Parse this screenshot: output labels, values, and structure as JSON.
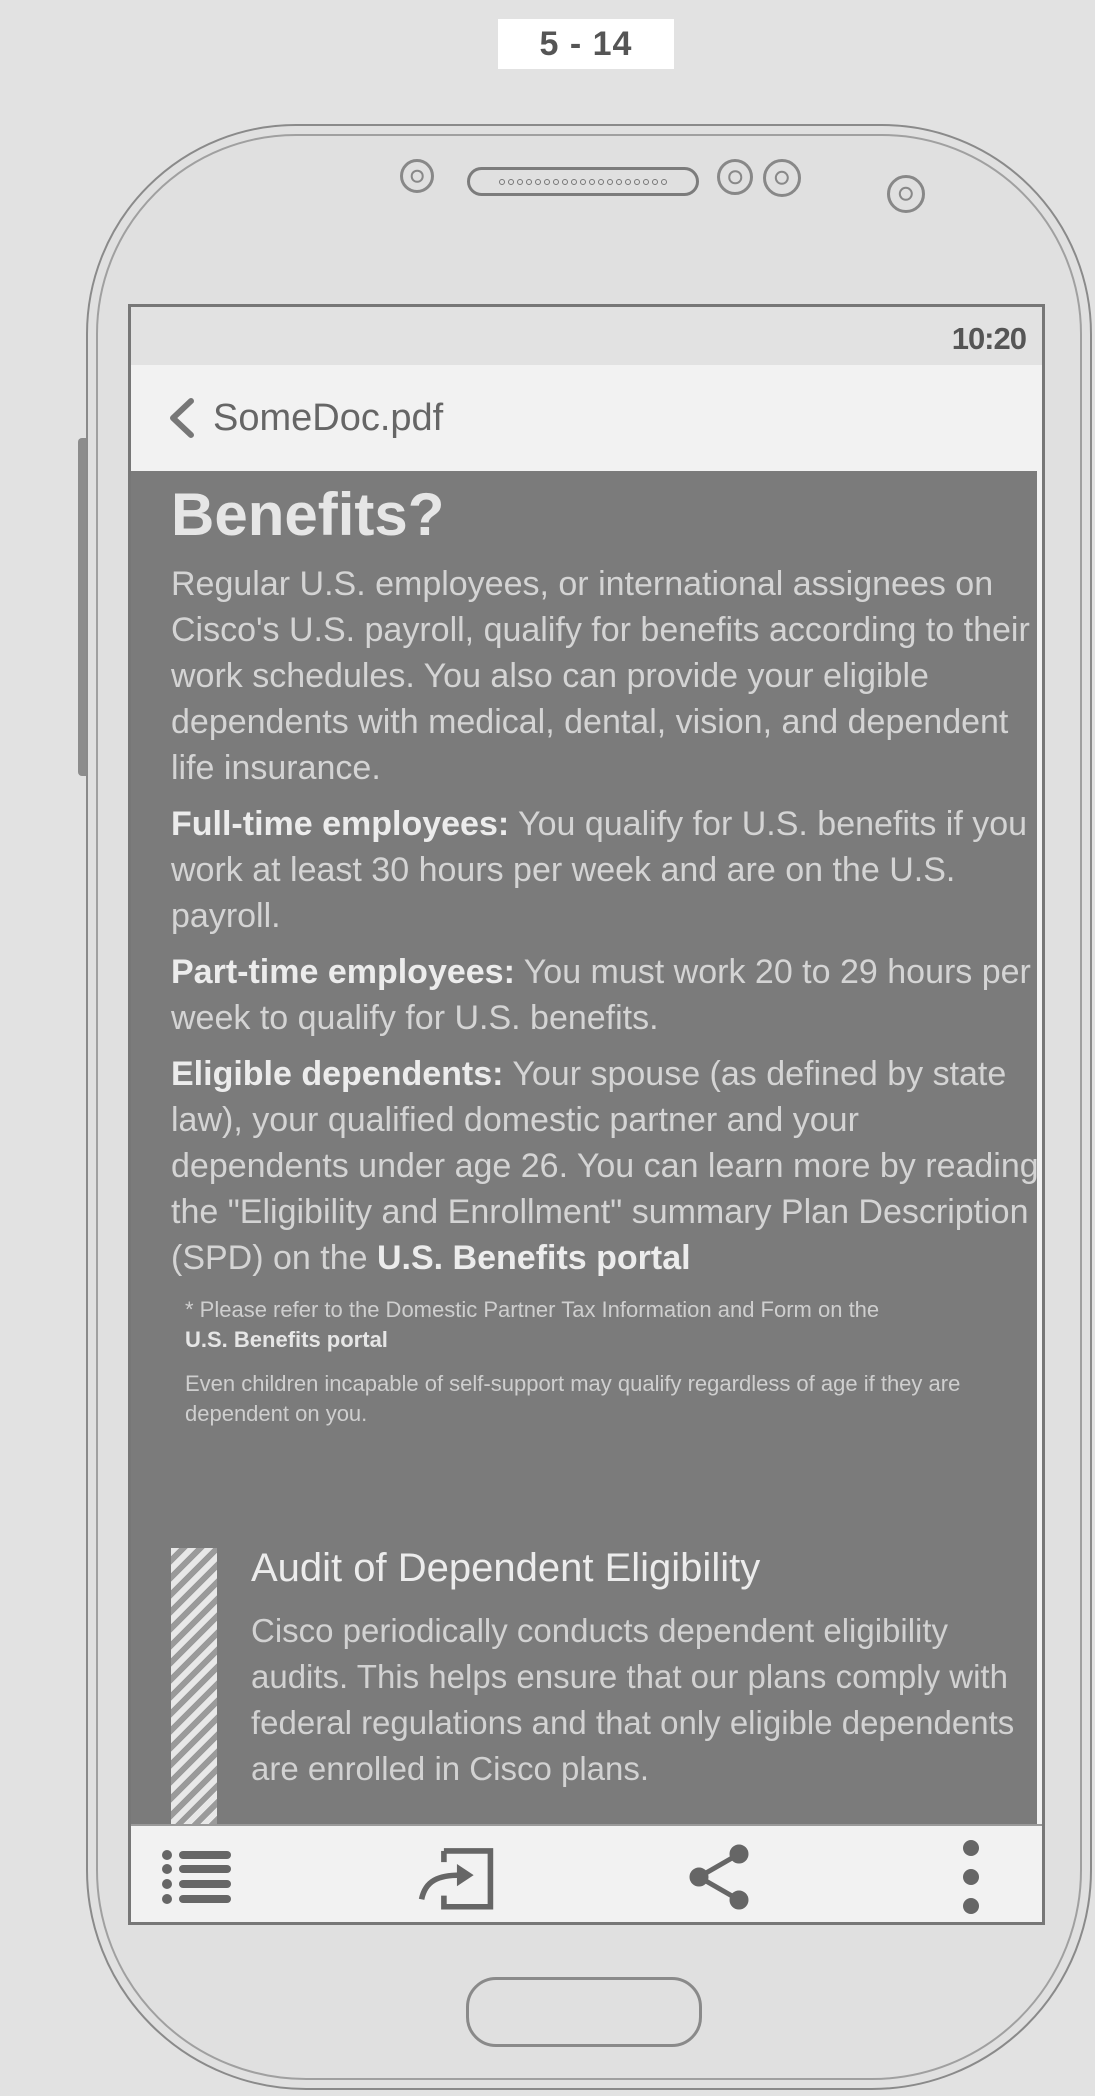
{
  "page_label": "5 - 14",
  "status_bar": {
    "time": "10:20"
  },
  "title_bar": {
    "back_icon": "chevron-left-icon",
    "title": "SomeDoc.pdf"
  },
  "document": {
    "heading": "Benefits?",
    "intro": "Regular U.S. employees, or international assignees on Cisco's U.S. payroll, qualify for benefits according to their work schedules. You also can provide your eligible dependents with medical, dental, vision, and dependent life insurance.",
    "fulltime_label": "Full-time employees:",
    "fulltime_text": " You qualify for U.S. benefits if you work at least 30 hours per week and are on the U.S. payroll.",
    "parttime_label": "Part-time employees:",
    "parttime_text": " You must work 20 to 29 hours per week to qualify for U.S. benefits.",
    "dependents_label": "Eligible dependents:",
    "dependents_text": " Your spouse (as defined by state law), your qualified domestic partner and your dependents under age 26. You can learn more by reading the \"Eligibility and Enrollment\" summary Plan Description (SPD) on the ",
    "dependents_link": "U.S. Benefits portal",
    "footnote1_text": "* Please refer to the Domestic Partner Tax Information and Form on the",
    "footnote1_link": "U.S. Benefits portal",
    "footnote2_text": "Even children incapable of self-support may qualify regardless of age if they are dependent on you.",
    "audit_title": "Audit of Dependent Eligibility",
    "audit_text": "Cisco periodically conducts dependent eligibility audits. This helps ensure that our plans comply with federal regulations and that only eligible dependents are enrolled in Cisco plans."
  },
  "bottom_bar": {
    "menu_icon": "list-icon",
    "present_icon": "cast-icon",
    "share_icon": "share-icon",
    "more_icon": "more-vertical-icon"
  }
}
